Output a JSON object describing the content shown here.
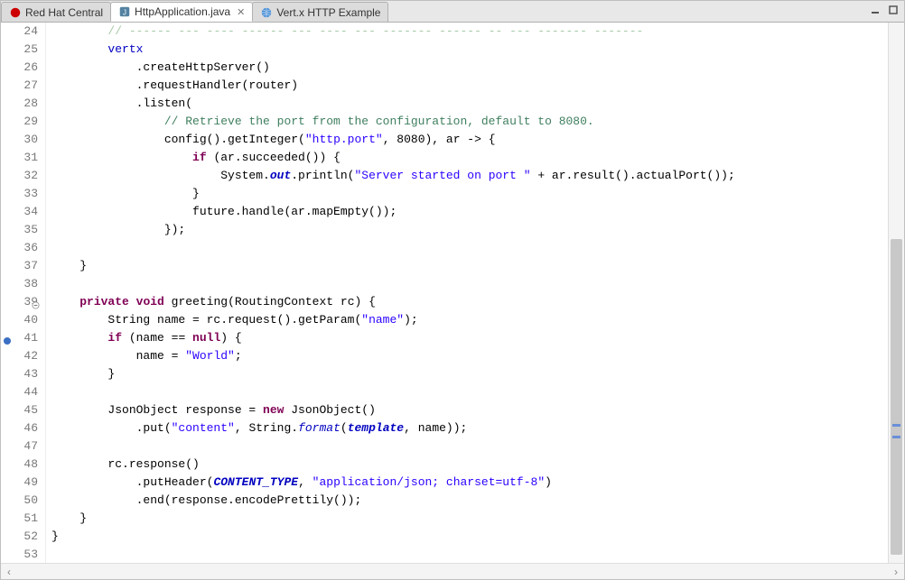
{
  "tabs": [
    {
      "label": "Red Hat Central",
      "icon": "redhat"
    },
    {
      "label": "HttpApplication.java",
      "icon": "java",
      "active": true,
      "closable": true
    },
    {
      "label": "Vert.x HTTP Example",
      "icon": "globe"
    }
  ],
  "line_start": 24,
  "lines": [
    {
      "n": 24,
      "indent": 2,
      "tokens": [
        {
          "t": "// ------ --- ---- ------ --- ---- --- ------- ------ -- --- ------- -------",
          "c": "comcut"
        }
      ]
    },
    {
      "n": 25,
      "indent": 2,
      "tokens": [
        {
          "t": "vertx",
          "c": "fld"
        }
      ]
    },
    {
      "n": 26,
      "indent": 3,
      "tokens": [
        {
          "t": ".createHttpServer()"
        }
      ]
    },
    {
      "n": 27,
      "indent": 3,
      "tokens": [
        {
          "t": ".requestHandler(router)"
        }
      ]
    },
    {
      "n": 28,
      "indent": 3,
      "tokens": [
        {
          "t": ".listen("
        }
      ]
    },
    {
      "n": 29,
      "indent": 4,
      "tokens": [
        {
          "t": "// Retrieve the port from the configuration, default to 8080.",
          "c": "com"
        }
      ]
    },
    {
      "n": 30,
      "indent": 4,
      "tokens": [
        {
          "t": "config().getInteger("
        },
        {
          "t": "\"http.port\"",
          "c": "str"
        },
        {
          "t": ", 8080), ar -> {"
        }
      ]
    },
    {
      "n": 31,
      "indent": 5,
      "tokens": [
        {
          "t": "if",
          "c": "kw"
        },
        {
          "t": " (ar.succeeded()) {"
        }
      ]
    },
    {
      "n": 32,
      "indent": 6,
      "tokens": [
        {
          "t": "System."
        },
        {
          "t": "out",
          "c": "fldi"
        },
        {
          "t": ".println("
        },
        {
          "t": "\"Server started on port \"",
          "c": "str"
        },
        {
          "t": " + ar.result().actualPort());"
        }
      ]
    },
    {
      "n": 33,
      "indent": 5,
      "tokens": [
        {
          "t": "}"
        }
      ]
    },
    {
      "n": 34,
      "indent": 5,
      "tokens": [
        {
          "t": "future.handle(ar.mapEmpty());"
        }
      ]
    },
    {
      "n": 35,
      "indent": 4,
      "tokens": [
        {
          "t": "});"
        }
      ]
    },
    {
      "n": 36,
      "indent": 0,
      "tokens": []
    },
    {
      "n": 37,
      "indent": 1,
      "tokens": [
        {
          "t": "}"
        }
      ]
    },
    {
      "n": 38,
      "indent": 0,
      "tokens": []
    },
    {
      "n": 39,
      "indent": 1,
      "fold": true,
      "tokens": [
        {
          "t": "private",
          "c": "kw"
        },
        {
          "t": " "
        },
        {
          "t": "void",
          "c": "kw"
        },
        {
          "t": " greeting(RoutingContext rc) {"
        }
      ]
    },
    {
      "n": 40,
      "indent": 2,
      "tokens": [
        {
          "t": "String name = rc.request().getParam("
        },
        {
          "t": "\"name\"",
          "c": "str"
        },
        {
          "t": ");"
        }
      ]
    },
    {
      "n": 41,
      "indent": 2,
      "bp": true,
      "tokens": [
        {
          "t": "if",
          "c": "kw"
        },
        {
          "t": " (name == "
        },
        {
          "t": "null",
          "c": "kw"
        },
        {
          "t": ") {"
        }
      ]
    },
    {
      "n": 42,
      "indent": 3,
      "tokens": [
        {
          "t": "name = "
        },
        {
          "t": "\"World\"",
          "c": "str"
        },
        {
          "t": ";"
        }
      ]
    },
    {
      "n": 43,
      "indent": 2,
      "tokens": [
        {
          "t": "}"
        }
      ]
    },
    {
      "n": 44,
      "indent": 0,
      "tokens": []
    },
    {
      "n": 45,
      "indent": 2,
      "tokens": [
        {
          "t": "JsonObject response = "
        },
        {
          "t": "new",
          "c": "kw"
        },
        {
          "t": " JsonObject()"
        }
      ]
    },
    {
      "n": 46,
      "indent": 3,
      "tokens": [
        {
          "t": ".put("
        },
        {
          "t": "\"content\"",
          "c": "str"
        },
        {
          "t": ", String."
        },
        {
          "t": "format",
          "c": "stat"
        },
        {
          "t": "("
        },
        {
          "t": "template",
          "c": "fldi"
        },
        {
          "t": ", name));"
        }
      ]
    },
    {
      "n": 47,
      "indent": 0,
      "tokens": []
    },
    {
      "n": 48,
      "indent": 2,
      "tokens": [
        {
          "t": "rc.response()"
        }
      ]
    },
    {
      "n": 49,
      "indent": 3,
      "tokens": [
        {
          "t": ".putHeader("
        },
        {
          "t": "CONTENT_TYPE",
          "c": "fldi"
        },
        {
          "t": ", "
        },
        {
          "t": "\"application/json; charset=utf-8\"",
          "c": "str"
        },
        {
          "t": ")"
        }
      ]
    },
    {
      "n": 50,
      "indent": 3,
      "tokens": [
        {
          "t": ".end(response.encodePrettily());"
        }
      ]
    },
    {
      "n": 51,
      "indent": 1,
      "tokens": [
        {
          "t": "}"
        }
      ]
    },
    {
      "n": 52,
      "indent": 0,
      "tokens": [
        {
          "t": "}"
        }
      ]
    },
    {
      "n": 53,
      "indent": 0,
      "tokens": []
    }
  ],
  "overview_marks": [
    445,
    458
  ]
}
